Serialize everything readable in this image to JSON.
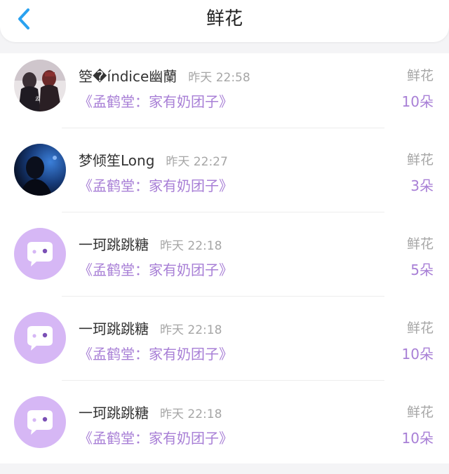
{
  "header": {
    "title": "鲜花",
    "back_icon": "chevron-left-icon",
    "accent": "#2aa2f0"
  },
  "colors": {
    "purple": "#a87fd6",
    "avatar_bg": "#d6b7f5",
    "gray": "#a6a6a6"
  },
  "items": [
    {
      "name": "箜�índice幽蘭",
      "time": "昨天 22:58",
      "book": "《孟鹤堂：家有奶团子》",
      "gift": "鲜花",
      "count": "10朵",
      "avatar": "photo-1"
    },
    {
      "name": "梦倾笙Long",
      "time": "昨天 22:27",
      "book": "《孟鹤堂：家有奶团子》",
      "gift": "鲜花",
      "count": "3朵",
      "avatar": "photo-2"
    },
    {
      "name": "一珂跳跳糖",
      "time": "昨天 22:18",
      "book": "《孟鹤堂：家有奶团子》",
      "gift": "鲜花",
      "count": "5朵",
      "avatar": "default-chat"
    },
    {
      "name": "一珂跳跳糖",
      "time": "昨天 22:18",
      "book": "《孟鹤堂：家有奶团子》",
      "gift": "鲜花",
      "count": "10朵",
      "avatar": "default-chat"
    },
    {
      "name": "一珂跳跳糖",
      "time": "昨天 22:18",
      "book": "《孟鹤堂：家有奶团子》",
      "gift": "鲜花",
      "count": "10朵",
      "avatar": "default-chat"
    }
  ]
}
